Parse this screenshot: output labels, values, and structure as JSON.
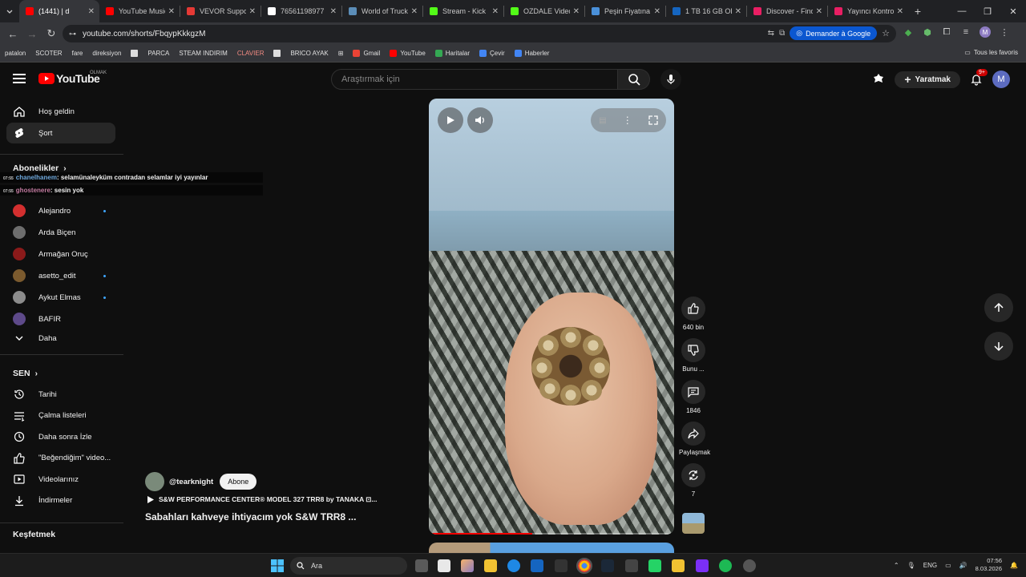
{
  "browser": {
    "tabs": [
      {
        "label": "(1441) | d",
        "color": "#ff0000",
        "active": true
      },
      {
        "label": "YouTube Music",
        "color": "#ff0000"
      },
      {
        "label": "VEVOR Suppor",
        "color": "#e53935"
      },
      {
        "label": "76561198977",
        "color": "#ffffff"
      },
      {
        "label": "World of Truck",
        "color": "#5b8db8"
      },
      {
        "label": "Stream - Kick",
        "color": "#53fc18"
      },
      {
        "label": "OZDALE Video",
        "color": "#53fc18"
      },
      {
        "label": "Peşin Fiyatına",
        "color": "#4a90d9"
      },
      {
        "label": "1 TB 16 GB OE",
        "color": "#1565c0"
      },
      {
        "label": "Discover - Find",
        "color": "#e91e63"
      },
      {
        "label": "Yayıncı Kontrol",
        "color": "#e91e63"
      }
    ],
    "url": "youtube.com/shorts/FbqypKkkgzM",
    "google_button": "Demander à Google",
    "bookmarks": [
      "patalon",
      "SCOTER",
      "fare",
      "direksiyon",
      "",
      "PARCA",
      "STEAM INDIRIM",
      "CLAVIER",
      "",
      "BRICO AYAK"
    ],
    "bookmarks_apps": [
      "Gmail",
      "YouTube",
      "Haritalar",
      "Çevir",
      "Haberler"
    ],
    "all_bookmarks": "Tous les favoris"
  },
  "youtube": {
    "logo_text": "YouTube",
    "logo_country": "OLMAK",
    "search_placeholder": "Araştırmak için",
    "create_label": "Yaratmak",
    "notif_badge": "9+",
    "avatar_letter": "M"
  },
  "sidebar": {
    "main": [
      {
        "label": "Hoş geldin",
        "icon": "home-icon"
      },
      {
        "label": "Şort",
        "icon": "shorts-icon",
        "active": true
      }
    ],
    "subs_heading": "Abonelikler",
    "subscriptions": [
      {
        "label": "Alejandro",
        "color": "#d32f2f",
        "dot": true
      },
      {
        "label": "Arda Biçen",
        "color": "#6d6d6d",
        "dot": false
      },
      {
        "label": "Armağan Oruç",
        "color": "#8b1a1a",
        "dot": false
      },
      {
        "label": "asetto_edit",
        "color": "#7b5a2e",
        "dot": true
      },
      {
        "label": "Aykut Elmas",
        "color": "#8c8c8c",
        "dot": true
      },
      {
        "label": "BAFIR",
        "color": "#5e4a8a",
        "dot": false
      }
    ],
    "more_label": "Daha",
    "you_heading": "SEN",
    "you_items": [
      {
        "label": "Tarihi",
        "icon": "history-icon"
      },
      {
        "label": "Çalma listeleri",
        "icon": "playlist-icon"
      },
      {
        "label": "Daha sonra İzle",
        "icon": "clock-icon"
      },
      {
        "label": "\"Beğendiğim\" video...",
        "icon": "like-icon"
      },
      {
        "label": "Videolarınız",
        "icon": "video-icon"
      },
      {
        "label": "İndirmeler",
        "icon": "download-icon"
      }
    ],
    "explore_heading": "Keşfetmek"
  },
  "chat_overlay": [
    {
      "time": "07:55",
      "user": "chanelhanem",
      "message": ": selamünaleyküm contradan selamlar iyi yayınlar"
    },
    {
      "time": "07:55",
      "user": "ghostenere",
      "message": ": sesin yok"
    }
  ],
  "short": {
    "channel": "@tearknight",
    "subscribe_label": "Abone",
    "song": "S&W PERFORMANCE CENTER® MODEL 327 TRR8 by TANAKA ⊡...",
    "title": "Sabahları kahveye ihtiyacım yok S&W TRR8 ...",
    "progress": 0.42,
    "actions": [
      {
        "label": "640 bin",
        "icon": "like-icon"
      },
      {
        "label": "Bunu ...",
        "icon": "dislike-icon"
      },
      {
        "label": "1846",
        "icon": "comment-icon"
      },
      {
        "label": "Paylaşmak",
        "icon": "share-icon"
      },
      {
        "label": "7",
        "icon": "remix-icon"
      }
    ]
  },
  "taskbar": {
    "search_label": "Ara",
    "lang": "ENG",
    "time": "07:56",
    "date": "8.03.2026"
  }
}
